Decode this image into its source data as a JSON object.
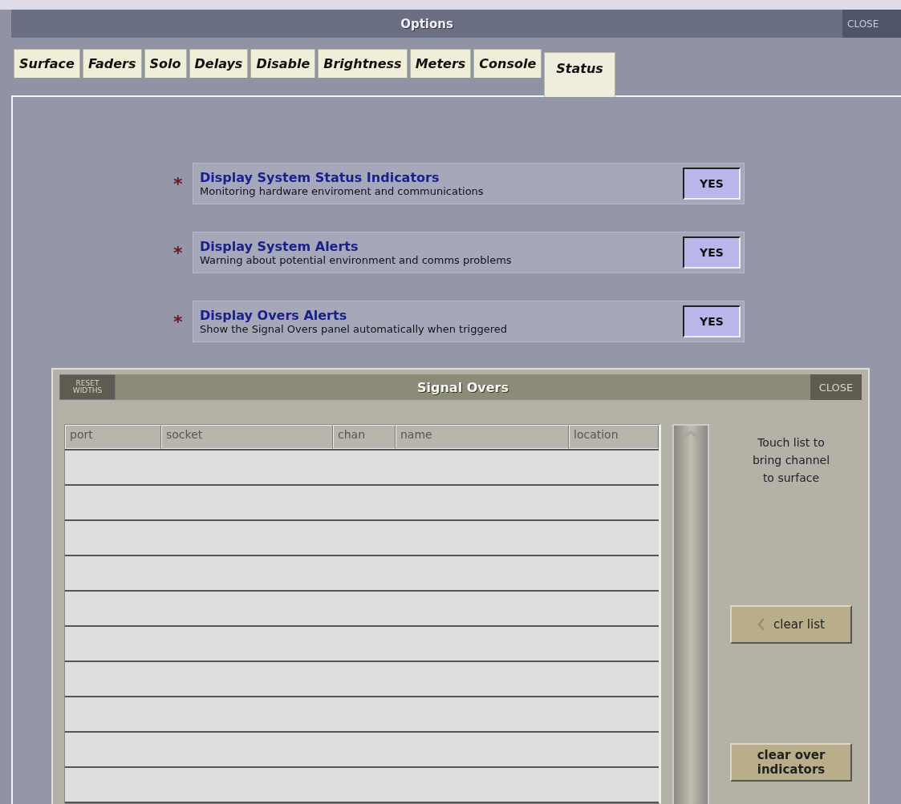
{
  "window": {
    "title": "Options",
    "close": "CLOSE"
  },
  "tabs": [
    {
      "label": "Surface",
      "selected": false
    },
    {
      "label": "Faders",
      "selected": false
    },
    {
      "label": "Solo",
      "selected": false
    },
    {
      "label": "Delays",
      "selected": false
    },
    {
      "label": "Disable",
      "selected": false
    },
    {
      "label": "Brightness",
      "selected": false
    },
    {
      "label": "Meters",
      "selected": false
    },
    {
      "label": "Console",
      "selected": false
    },
    {
      "label": "Status",
      "selected": true
    }
  ],
  "options": [
    {
      "marker": "*",
      "title": "Display System Status Indicators",
      "description": "Monitoring hardware enviroment and communications",
      "button": "YES",
      "on": true
    },
    {
      "marker": "*",
      "title": "Display System Alerts",
      "description": "Warning about potential environment and comms problems",
      "button": "YES",
      "on": true
    },
    {
      "marker": "*",
      "title": "Display Overs Alerts",
      "description": "Show the Signal Overs panel automatically when triggered",
      "button": "YES",
      "on": true
    }
  ],
  "signal_overs": {
    "title": "Signal Overs",
    "reset_button": "RESET WIDTHS",
    "close": "CLOSE",
    "columns": [
      "port",
      "socket",
      "chan",
      "name",
      "location"
    ],
    "hint": "Touch list to bring channel to surface",
    "clear_list": "clear list",
    "clear_indicators": "clear over indicators"
  }
}
